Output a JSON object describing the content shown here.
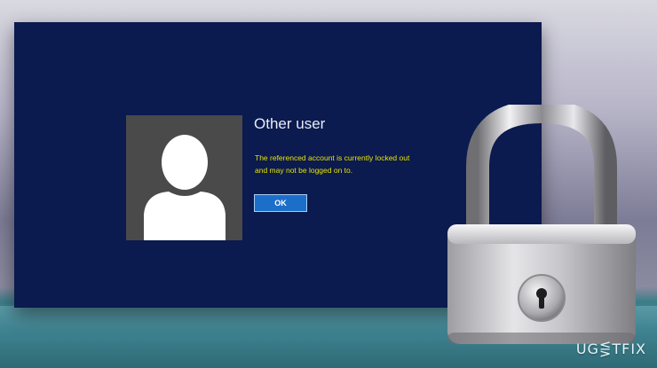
{
  "dialog": {
    "title": "Other user",
    "message_line1": "The referenced account is currently locked out",
    "message_line2": "and may not be logged on to.",
    "ok_label": "OK"
  },
  "watermark": {
    "text": "UG⋚TFIX"
  },
  "icons": {
    "avatar": "user-silhouette-icon",
    "lock": "padlock-icon"
  },
  "colors": {
    "screen_bg": "#0b1a4f",
    "message_text": "#e6e400",
    "ok_button": "#1c6fc9",
    "avatar_tile": "#4a4a4a"
  }
}
